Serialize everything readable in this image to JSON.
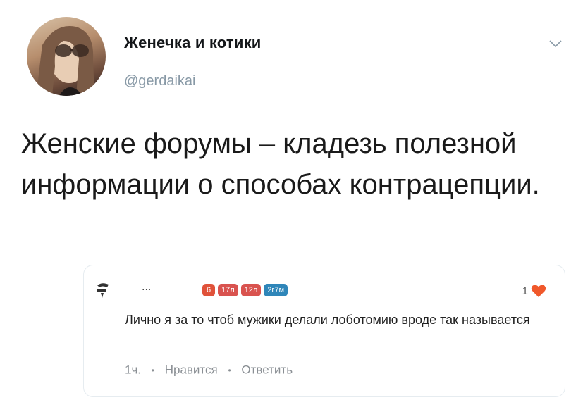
{
  "author": {
    "display_name": "Женечка и котики",
    "handle": "@gerdaikai"
  },
  "tweet": {
    "text": "Женские форумы – кладезь полезной информации о способах контрацепции."
  },
  "comment": {
    "username": "...",
    "badges": [
      {
        "label": "6",
        "color": "#e0523a"
      },
      {
        "label": "17л",
        "color": "#d9534f"
      },
      {
        "label": "12л",
        "color": "#d9534f"
      },
      {
        "label": "2г7м",
        "color": "#2f86b9"
      }
    ],
    "like_count": "1",
    "text": "Лично я за то чтоб мужики делали лоботомию вроде так называется",
    "time": "1ч.",
    "like_action": "Нравится",
    "reply_action": "Ответить"
  },
  "colors": {
    "heart": "#f0582b",
    "muted": "#8899a6"
  },
  "icons": {
    "menu": "chevron-down-icon",
    "like": "heart-icon"
  }
}
